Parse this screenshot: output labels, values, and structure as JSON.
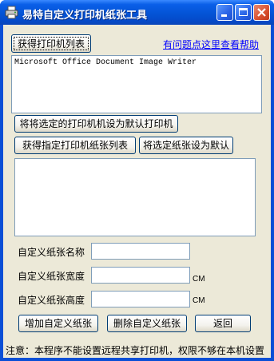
{
  "window": {
    "title": "易特自定义打印机纸张工具"
  },
  "toolbar": {
    "get_printers_label": "获得打印机列表",
    "help_link": "有问题点这里查看帮助"
  },
  "printers": {
    "items": [
      "Microsoft Office Document Image Writer"
    ]
  },
  "actions": {
    "set_default_printer_label": "将将选定的打印机机设为默认打印机",
    "get_papers_label": "获得指定打印机纸张列表",
    "set_default_paper_label": "将选定纸张设为默认"
  },
  "paper_form": {
    "name_label": "自定义纸张名称",
    "name_value": "",
    "width_label": "自定义纸张宽度",
    "width_value": "",
    "width_unit": "CM",
    "height_label": "自定义纸张高度",
    "height_value": "",
    "height_unit": "CM"
  },
  "bottom_buttons": {
    "add_label": "增加自定义纸张",
    "delete_label": "删除自定义纸张",
    "back_label": "返回"
  },
  "footer": {
    "note": "注意：本程序不能设置远程共享打印机，权限不够在本机设置"
  }
}
